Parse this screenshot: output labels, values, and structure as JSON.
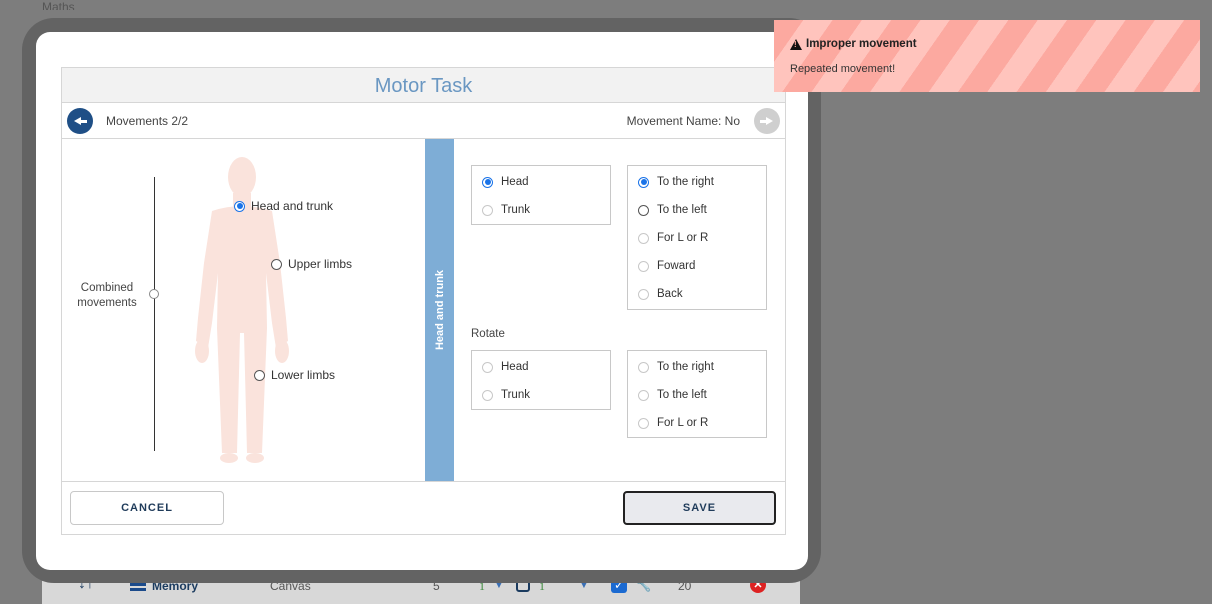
{
  "background": {
    "top_label": "Maths",
    "row": {
      "sort_icon": "sort-arrows-icon",
      "memory_label": "Memory",
      "canvas_label": "Canvas",
      "count": "5",
      "value1": "1",
      "value2": "1",
      "number": "20"
    }
  },
  "dialog": {
    "title": "Motor Task",
    "movements_label": "Movements 2/2",
    "movement_name_label": "Movement Name: No",
    "combined_movements_label": "Combined movements",
    "body_parts": [
      {
        "label": "Head and trunk",
        "selected": true
      },
      {
        "label": "Upper limbs",
        "selected": false
      },
      {
        "label": "Lower limbs",
        "selected": false
      }
    ],
    "section_tab_label": "Head and trunk",
    "group1": {
      "parts": [
        {
          "label": "Head",
          "state": "selected"
        },
        {
          "label": "Trunk",
          "state": "disabled"
        }
      ],
      "directions": [
        {
          "label": "To the right",
          "state": "selected"
        },
        {
          "label": "To the left",
          "state": "unselected"
        },
        {
          "label": "For L or R",
          "state": "disabled"
        },
        {
          "label": "Foward",
          "state": "disabled"
        },
        {
          "label": "Back",
          "state": "disabled"
        }
      ]
    },
    "rotate_label": "Rotate",
    "group2": {
      "parts": [
        {
          "label": "Head",
          "state": "disabled"
        },
        {
          "label": "Trunk",
          "state": "disabled"
        }
      ],
      "directions": [
        {
          "label": "To the right",
          "state": "disabled"
        },
        {
          "label": "To the left",
          "state": "disabled"
        },
        {
          "label": "For L or R",
          "state": "disabled"
        }
      ]
    },
    "cancel_label": "CANCEL",
    "save_label": "SAVE"
  },
  "toast": {
    "title": "Improper movement",
    "message": "Repeated movement!"
  },
  "colors": {
    "title_text": "#6a97c2",
    "nav_button": "#1f4f86",
    "section_tab": "#7eadd6",
    "radio_selected": "#1a73e8",
    "toast_bg": "#fca9a0",
    "body_silhouette": "#fae3dc"
  }
}
